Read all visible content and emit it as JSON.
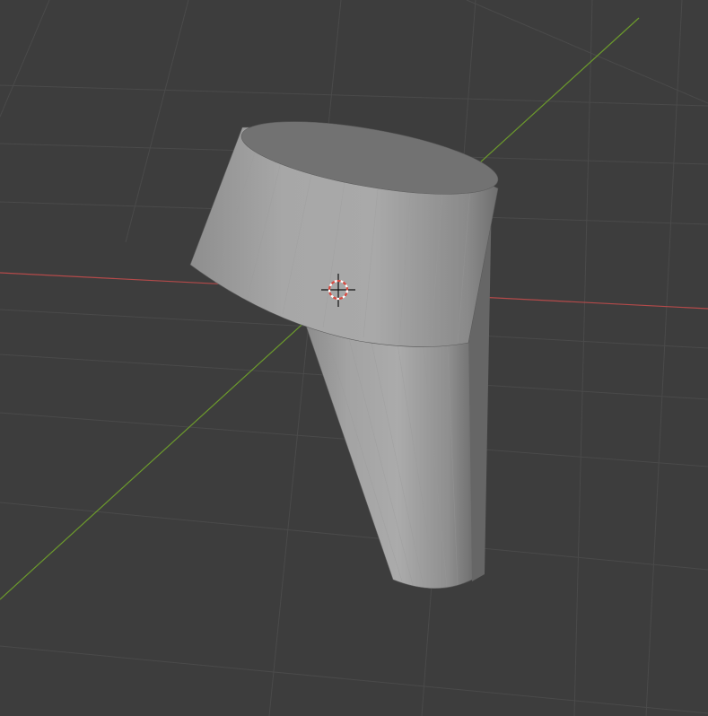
{
  "viewport": {
    "type": "3d-viewport",
    "background_color": "#3d3d3d",
    "grid_color": "#4a4a4a",
    "x_axis_color": "#b44a4a",
    "y_axis_color": "#6c9a2c"
  },
  "scene_objects": [
    {
      "kind": "mesh",
      "shape": "tapered-cylinder-with-tilted-disc-top",
      "material_color": "#a6a6a6"
    }
  ],
  "cursor": {
    "icon": "3d-cursor-icon",
    "ring_colors": [
      "#d8493f",
      "#ffffff"
    ]
  }
}
